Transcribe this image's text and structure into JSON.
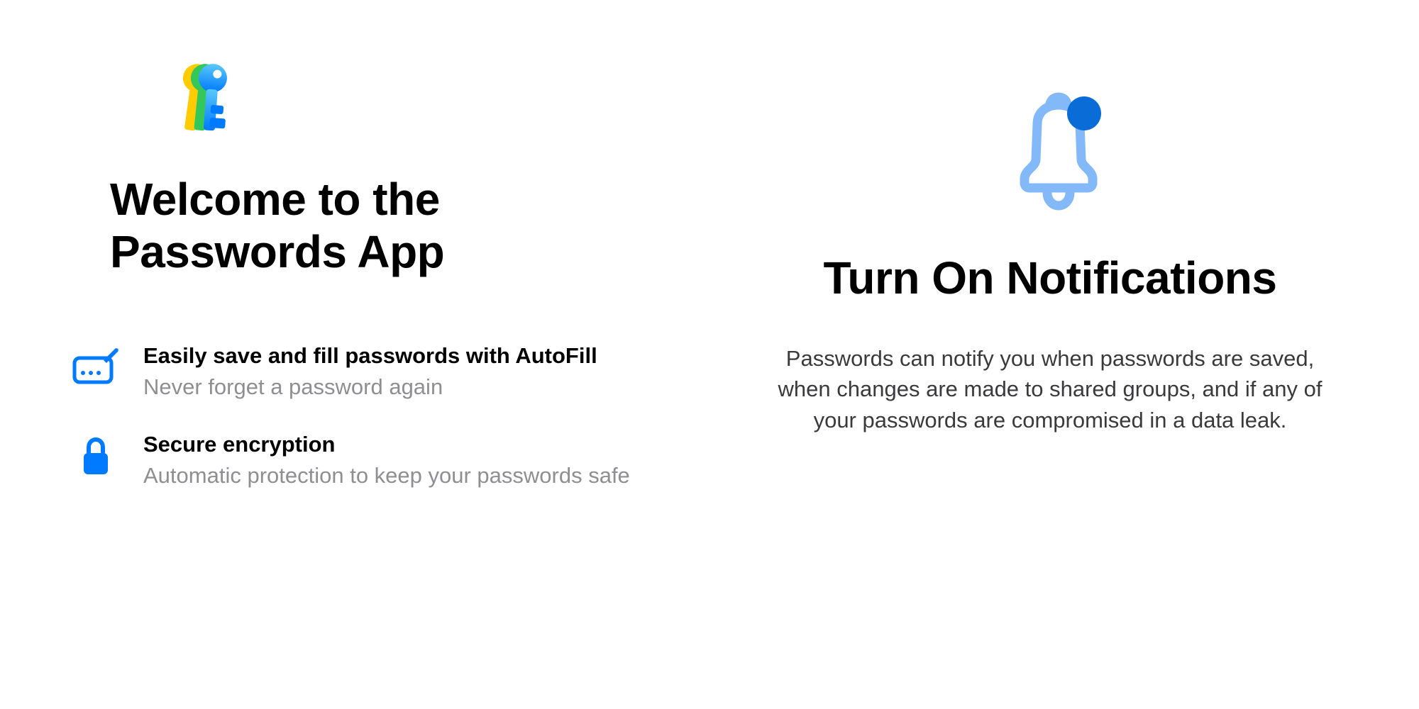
{
  "left": {
    "title": "Welcome to the Passwords App",
    "features": [
      {
        "title": "Easily save and fill passwords with AutoFill",
        "subtitle": "Never forget a password again"
      },
      {
        "title": "Secure encryption",
        "subtitle": "Automatic protection to keep your passwords safe"
      }
    ]
  },
  "right": {
    "title": "Turn On Notifications",
    "body": "Passwords can notify you when passwords are saved, when changes are made to shared groups, and if any of your passwords are compromised in a data leak."
  },
  "colors": {
    "accent": "#007aff",
    "bellStroke": "#83b9f9",
    "badge": "#0a6cd6",
    "grayText": "#8e8e93",
    "keyYellow": "#ffcc00",
    "keyGreen": "#34c759",
    "keyBlueTop": "#5ac8fa",
    "keyBlueBottom": "#007aff"
  }
}
